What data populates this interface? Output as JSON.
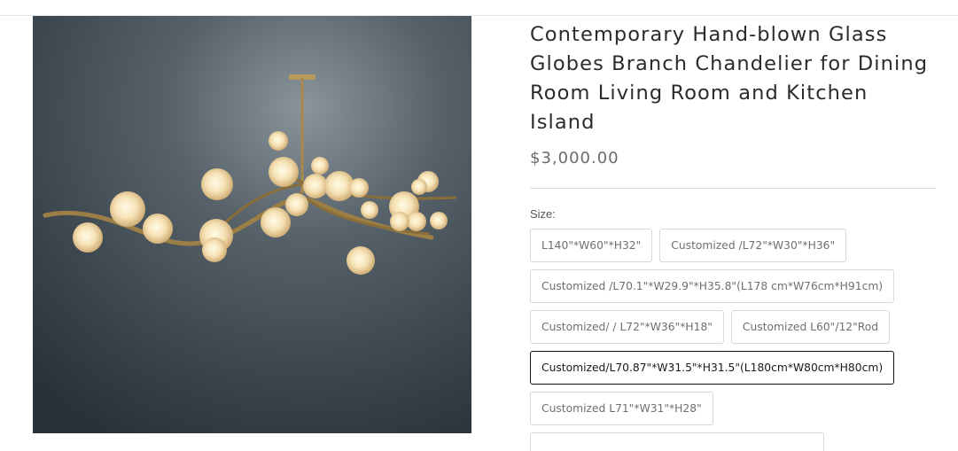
{
  "product": {
    "title": "Contemporary Hand-blown Glass Globes Branch Chandelier for Dining Room Living Room and Kitchen Island",
    "price": "$3,000.00"
  },
  "options": {
    "size_label": "Size:",
    "sizes": [
      "L140\"*W60\"*H32\"",
      "Customized /L72\"*W30\"*H36\"",
      "Customized /L70.1\"*W29.9\"*H35.8\"(L178 cm*W76cm*H91cm)",
      "Customized/ / L72\"*W36\"*H18\"",
      "Customized L60\"/12\"Rod",
      "Customized/L70.87\"*W31.5\"*H31.5\"(L180cm*W80cm*H80cm)",
      "Customized L71\"*W31\"*H28\""
    ],
    "selected": "Customized/L70.87\"*W31.5\"*H31.5\"(L180cm*W80cm*H80cm)"
  },
  "icons": {
    "product_image": "chandelier-photo"
  }
}
